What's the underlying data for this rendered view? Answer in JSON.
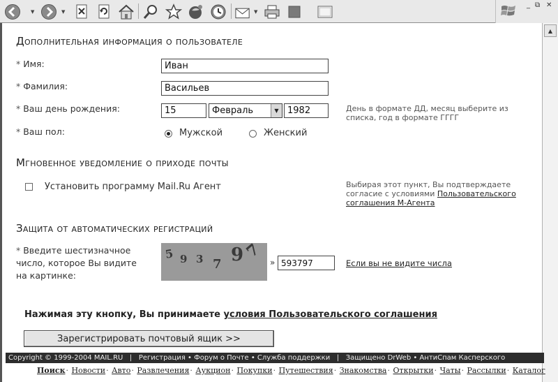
{
  "toolbar": {
    "buttons": [
      "back-icon",
      "forward-icon",
      "stop-icon",
      "refresh-icon",
      "home-icon",
      "search-icon",
      "favorites-icon",
      "media-icon",
      "history-icon",
      "mail-icon",
      "print-icon",
      "edit-icon",
      "discuss-icon"
    ],
    "window_controls": "_ ⧉ ✕"
  },
  "section_user": {
    "heading": "Дополнительная информация о пользователе",
    "name_label": "Имя:",
    "name_value": "Иван",
    "surname_label": "Фамилия:",
    "surname_value": "Васильев",
    "birthday_label": "Ваш день рождения:",
    "day_value": "15",
    "month_value": "Февраль",
    "year_value": "1982",
    "birthday_hint": "День в формате ДД, месяц выберите из списка, год в формате ГГГГ",
    "gender_label": "Ваш пол:",
    "male_label": "Мужской",
    "female_label": "Женский",
    "required_mark": "*"
  },
  "section_notify": {
    "heading": "Мгновенное уведомление о приходе почты",
    "checkbox_label": "Установить программу Mail.Ru Агент",
    "hint_text": "Выбирая этот пункт, Вы подтверждаете согласие с условиями ",
    "hint_link": "Пользовательского соглашения М-Агента"
  },
  "section_captcha": {
    "heading": "Защита от автоматических регистраций",
    "label": "Введите шестизначное число, которое Вы видите на картинке:",
    "captcha_chars": [
      "5",
      "9",
      "3",
      "7",
      "9",
      "7"
    ],
    "arrow": "»",
    "input_value": "593797",
    "cant_see_link": "Если вы не видите числа"
  },
  "agreement": {
    "text": "Нажимая эту кнопку, Вы принимаете ",
    "link": "условия Пользовательского соглашения"
  },
  "submit_label": "Зарегистрировать почтовый ящик >>",
  "footer": {
    "copyright": "Copyright © 1999-2004 MAIL.RU",
    "separator": "|",
    "links_center": "Регистрация • Форум о Почте • Служба поддержки",
    "links_right": "Защищено DrWeb • АнтиСпам Касперского"
  },
  "bottom_nav": [
    "Поиск",
    "Новости",
    "Авто",
    "Развлечения",
    "Аукцион",
    "Покупки",
    "Путешествия",
    "Знакомства",
    "Открытки",
    "Чаты",
    "Рассылки",
    "Каталог"
  ],
  "bottom_nav_sep": "·"
}
